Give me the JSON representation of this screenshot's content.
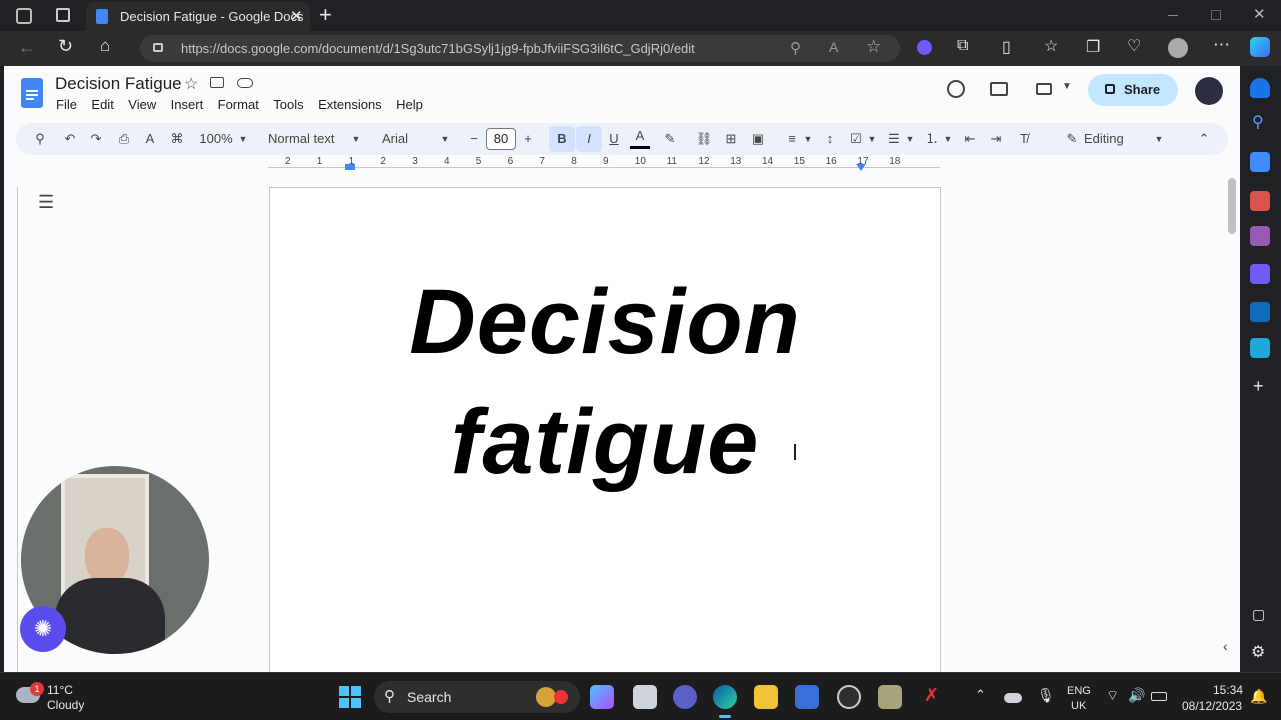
{
  "browser": {
    "tab_title": "Decision Fatigue - Google Docs",
    "url": "https://docs.google.com/document/d/1Sg3utc71bGSylj1jg9-fpbJfviiFSG3il6tC_GdjRj0/edit"
  },
  "doc": {
    "title": "Decision Fatigue",
    "menu": [
      "File",
      "Edit",
      "View",
      "Insert",
      "Format",
      "Tools",
      "Extensions",
      "Help"
    ],
    "share_label": "Share",
    "toolbar": {
      "zoom": "100%",
      "style": "Normal text",
      "font": "Arial",
      "font_size": "80",
      "mode": "Editing"
    },
    "ruler_ticks": [
      "2",
      "1",
      "1",
      "2",
      "3",
      "4",
      "5",
      "6",
      "7",
      "8",
      "9",
      "10",
      "11",
      "12",
      "13",
      "14",
      "15",
      "16",
      "17",
      "18"
    ],
    "body_line1": "Decision",
    "body_line2": "fatigue"
  },
  "taskbar": {
    "weather_temp": "11°C",
    "weather_desc": "Cloudy",
    "weather_badge": "1",
    "search_label": "Search",
    "lang_top": "ENG",
    "lang_bottom": "UK",
    "time": "15:34",
    "date": "08/12/2023"
  },
  "colors": {
    "brand_blue": "#4285f4",
    "share_bg": "#c2e7ff",
    "toolbar_bg": "#edf2fa"
  }
}
